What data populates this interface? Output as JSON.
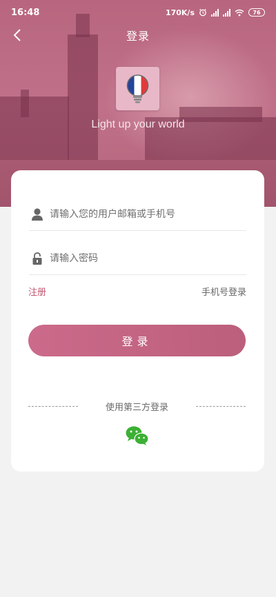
{
  "status_bar": {
    "time": "16:48",
    "network_speed": "170K/s",
    "battery_level": "76",
    "icons": [
      "alarm-icon",
      "signal-icon",
      "signal-icon",
      "wifi-icon",
      "battery-icon"
    ]
  },
  "nav": {
    "title": "登录",
    "back_icon": "chevron-left-icon"
  },
  "hero": {
    "slogan": "Light up your world",
    "logo_icon": "french-flag-lightbulb-icon"
  },
  "form": {
    "username_placeholder": "请输入您的用户邮箱或手机号",
    "username_value": "",
    "username_icon": "user-icon",
    "password_placeholder": "请输入密码",
    "password_value": "",
    "password_icon": "lock-icon",
    "register_label": "注册",
    "phone_login_label": "手机号登录",
    "login_button_label": "登录"
  },
  "third_party": {
    "label": "使用第三方登录",
    "providers": [
      "wechat-icon"
    ]
  },
  "colors": {
    "accent": "#c2566f",
    "button_gradient_start": "#cc6a8a",
    "button_gradient_end": "#bb5f7c",
    "hero_tint": "#b8667f",
    "wechat_green": "#3cb034",
    "page_background": "#f2f2f2"
  }
}
